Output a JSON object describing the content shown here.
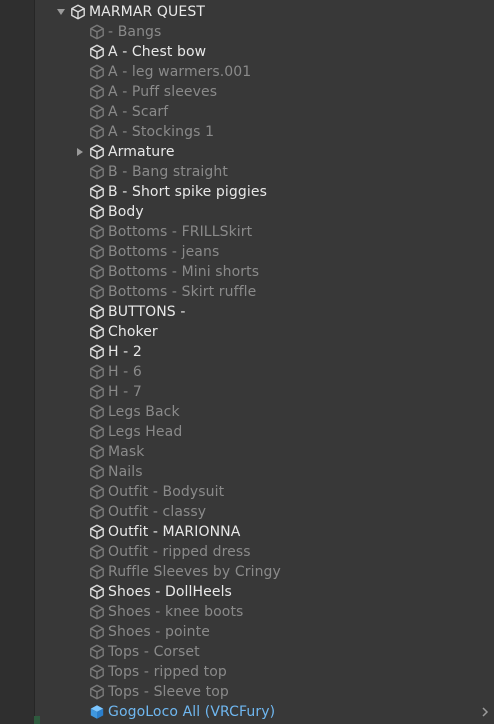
{
  "hierarchy": {
    "root": {
      "label": "MARMAR QUEST",
      "icon": "cube-icon",
      "expanded": true
    },
    "children": [
      {
        "label": "- Bangs",
        "state": "inactive"
      },
      {
        "label": "A - Chest bow",
        "state": "active"
      },
      {
        "label": "A - leg warmers.001",
        "state": "inactive"
      },
      {
        "label": "A - Puff sleeves",
        "state": "inactive"
      },
      {
        "label": "A - Scarf",
        "state": "inactive"
      },
      {
        "label": "A - Stockings 1",
        "state": "inactive"
      },
      {
        "label": "Armature",
        "state": "active",
        "collapsed_arrow": true
      },
      {
        "label": "B - Bang straight",
        "state": "inactive"
      },
      {
        "label": "B - Short spike piggies",
        "state": "active"
      },
      {
        "label": "Body",
        "state": "active"
      },
      {
        "label": "Bottoms - FRILLSkirt",
        "state": "inactive"
      },
      {
        "label": "Bottoms - jeans",
        "state": "inactive"
      },
      {
        "label": "Bottoms - Mini shorts",
        "state": "inactive"
      },
      {
        "label": "Bottoms - Skirt ruffle",
        "state": "inactive"
      },
      {
        "label": "BUTTONS -",
        "state": "active"
      },
      {
        "label": "Choker",
        "state": "active"
      },
      {
        "label": "H - 2",
        "state": "active"
      },
      {
        "label": "H - 6",
        "state": "inactive"
      },
      {
        "label": "H - 7",
        "state": "inactive"
      },
      {
        "label": "Legs Back",
        "state": "inactive"
      },
      {
        "label": "Legs Head",
        "state": "inactive"
      },
      {
        "label": "Mask",
        "state": "inactive"
      },
      {
        "label": "Nails",
        "state": "inactive"
      },
      {
        "label": "Outfit - Bodysuit",
        "state": "inactive"
      },
      {
        "label": "Outfit - classy",
        "state": "inactive"
      },
      {
        "label": "Outfit - MARIONNA",
        "state": "active"
      },
      {
        "label": "Outfit - ripped dress",
        "state": "inactive"
      },
      {
        "label": "Ruffle Sleeves by Cringy",
        "state": "inactive"
      },
      {
        "label": "Shoes - DollHeels",
        "state": "active"
      },
      {
        "label": "Shoes - knee boots",
        "state": "inactive"
      },
      {
        "label": "Shoes - pointe",
        "state": "inactive"
      },
      {
        "label": "Tops - Corset",
        "state": "inactive"
      },
      {
        "label": "Tops - ripped top",
        "state": "inactive"
      },
      {
        "label": "Tops - Sleeve top",
        "state": "inactive"
      },
      {
        "label": "GogoLoco All (VRCFury)",
        "state": "prefab",
        "has_child_chevron": true
      }
    ]
  },
  "colors": {
    "background": "#383838",
    "active_text": "#e8e8e8",
    "inactive_text": "#8a8a8a",
    "prefab_text": "#6fb7f0",
    "active_icon": "#dcdcdc",
    "inactive_icon": "#7a7a7a",
    "prefab_icon": "#5aaef0"
  }
}
